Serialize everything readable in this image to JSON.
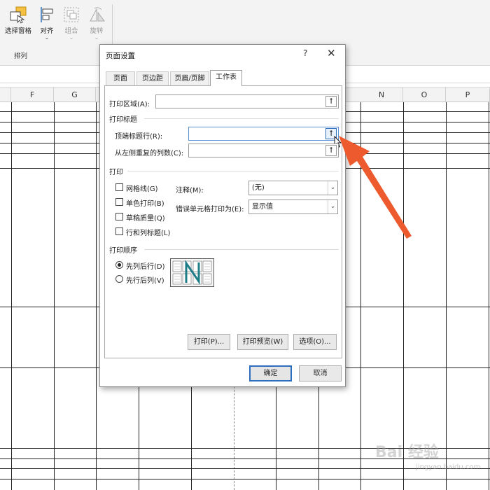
{
  "ribbon": {
    "selection_pane": "选择窗格",
    "align": "对齐",
    "group": "组合",
    "rotate": "旋转",
    "group_label": "排列"
  },
  "columns": [
    "F",
    "G",
    "N",
    "O",
    "P"
  ],
  "dialog": {
    "title": "页面设置",
    "help": "?",
    "close": "✕",
    "tabs": [
      "页面",
      "页边距",
      "页眉/页脚",
      "工作表"
    ],
    "print_area_label": "打印区域(A):",
    "print_titles_section": "打印标题",
    "rows_repeat_label": "顶端标题行(R):",
    "cols_repeat_label": "从左侧重复的列数(C):",
    "print_section": "打印",
    "gridlines": "网格线(G)",
    "black_white": "单色打印(B)",
    "draft": "草稿质量(Q)",
    "row_col_headings": "行和列标题(L)",
    "comments_label": "注释(M):",
    "comments_value": "(无)",
    "cell_errors_label": "错误单元格打印为(E):",
    "cell_errors_value": "显示值",
    "page_order_section": "打印顺序",
    "down_then_over": "先列后行(D)",
    "over_then_down": "先行后列(V)",
    "print_button": "打印(P)...",
    "preview_button": "打印预览(W)",
    "options_button": "选项(O)...",
    "ok_button": "确定",
    "cancel_button": "取消",
    "up_glyph": "⭡"
  },
  "watermark": {
    "logo": "Bai 经验",
    "url": "jingyan.baidu.com"
  },
  "colors": {
    "annotation_arrow": "#ec5a2e",
    "focus_blue": "#2a6ebd"
  }
}
